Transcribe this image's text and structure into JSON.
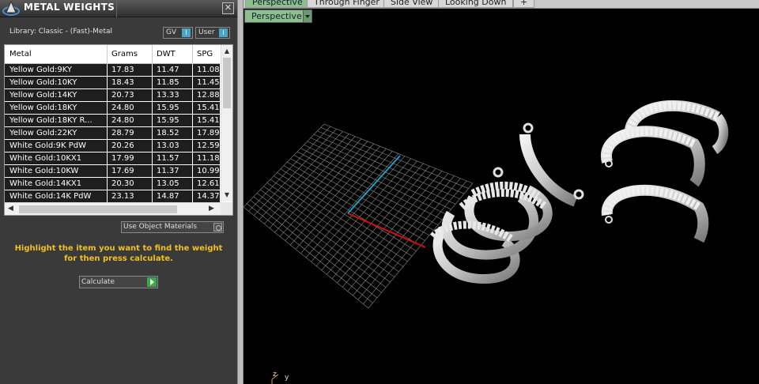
{
  "panel": {
    "title": "METAL WEIGHTS",
    "close": "✕",
    "library": "Library: Classic - (Fast)-Metal",
    "toggles": [
      {
        "label": "GV",
        "knob": "I"
      },
      {
        "label": "User",
        "knob": "I"
      }
    ]
  },
  "table": {
    "columns": [
      "Metal",
      "Grams",
      "DWT",
      "SPG"
    ],
    "rows": [
      [
        "Yellow Gold:9KY",
        "17.83",
        "11.47",
        "11.08"
      ],
      [
        "Yellow Gold:10KY",
        "18.43",
        "11.85",
        "11.45"
      ],
      [
        "Yellow Gold:14KY",
        "20.73",
        "13.33",
        "12.88"
      ],
      [
        "Yellow Gold:18KY",
        "24.80",
        "15.95",
        "15.41"
      ],
      [
        "Yellow Gold:18KY R...",
        "24.80",
        "15.95",
        "15.41"
      ],
      [
        "Yellow Gold:22KY",
        "28.79",
        "18.52",
        "17.89"
      ],
      [
        "White Gold:9K PdW",
        "20.26",
        "13.03",
        "12.59"
      ],
      [
        "White Gold:10KX1",
        "17.99",
        "11.57",
        "11.18"
      ],
      [
        "White Gold:10KW",
        "17.69",
        "11.37",
        "10.99"
      ],
      [
        "White Gold:14KX1",
        "20.30",
        "13.05",
        "12.61"
      ],
      [
        "White Gold:14K PdW",
        "23.13",
        "14.87",
        "14.37"
      ]
    ]
  },
  "use_object_materials": "Use Object Materials",
  "hint": "Highlight the item you want to find the weight for then press calculate.",
  "calculate_label": "Calculate",
  "viewport": {
    "tabs": [
      "Perspective",
      "Through Finger",
      "Side View",
      "Looking Down",
      "+"
    ],
    "view_dropdown": "Perspective",
    "axis_z": "z",
    "axis_y": "y"
  }
}
